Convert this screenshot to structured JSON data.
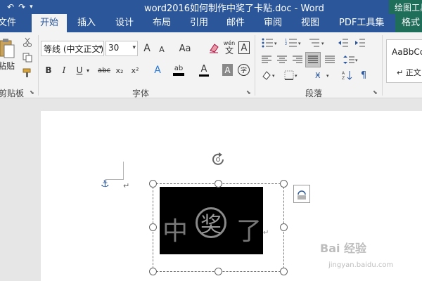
{
  "window": {
    "title": "word2016如何制作中奖了卡贴.doc - Word",
    "context_tab_group": "绘图工具"
  },
  "quick_access": {
    "undo_icon": "undo-icon",
    "redo_icon": "redo-icon",
    "customize_icon": "dropdown-icon"
  },
  "tabs": [
    {
      "label": "文件"
    },
    {
      "label": "开始",
      "active": true
    },
    {
      "label": "插入"
    },
    {
      "label": "设计"
    },
    {
      "label": "布局"
    },
    {
      "label": "引用"
    },
    {
      "label": "邮件"
    },
    {
      "label": "审阅"
    },
    {
      "label": "视图"
    },
    {
      "label": "PDF工具集"
    },
    {
      "label": "格式"
    }
  ],
  "ribbon": {
    "clipboard": {
      "label": "剪贴板",
      "paste_label": "粘贴",
      "cut_icon": "scissors-icon",
      "copy_icon": "copy-icon",
      "format_painter_icon": "format-painter-icon"
    },
    "font": {
      "label": "字体",
      "font_name": "等线 (中文正文)",
      "font_size": "30",
      "grow_font": "A",
      "shrink_font": "A",
      "change_case": "Aa",
      "pinyin_top": "wén",
      "pinyin_char": "文",
      "char_border": "A",
      "bold": "B",
      "italic": "I",
      "underline": "U",
      "strikethrough": "abc",
      "subscript": "x₂",
      "superscript": "x²",
      "text_effect": "A",
      "highlight": "ab",
      "font_color": "A",
      "char_shading": "A",
      "enclose_char": "字"
    },
    "paragraph": {
      "label": "段落"
    },
    "styles": {
      "preview": "AaBbCcDc",
      "normal_label": "↵ 正文"
    }
  },
  "document": {
    "anchor_icon": "anchor-icon",
    "paragraph_mark": "↵",
    "text_zhong": "中",
    "text_jiang": "奖",
    "text_le": "了",
    "rotate_icon": "rotate-handle-icon",
    "layout_options_icon": "layout-options-icon"
  },
  "watermark": {
    "main": "Bai 经验",
    "sub": "jingyan.baidu.com"
  },
  "colors": {
    "word_blue": "#2b579a",
    "drawing_tools_green": "#1e6e5a",
    "ribbon_bg": "#f3f3f3",
    "doc_bg": "#e6e6e6"
  }
}
